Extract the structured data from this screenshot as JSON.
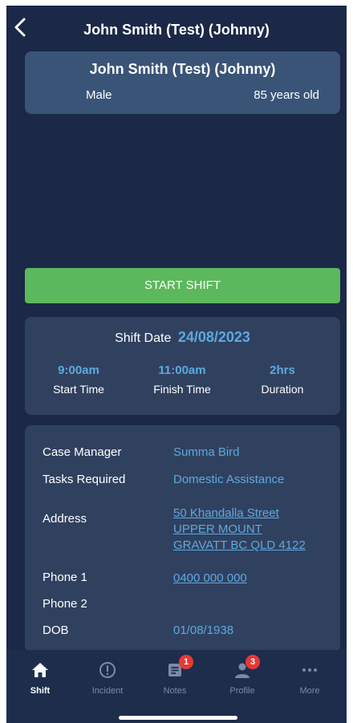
{
  "header": {
    "title": "John Smith (Test) (Johnny)"
  },
  "client": {
    "name": "John Smith (Test) (Johnny)",
    "gender": "Male",
    "age": "85 years old"
  },
  "actions": {
    "start_shift": "START SHIFT"
  },
  "shift": {
    "date_label": "Shift Date",
    "date_value": "24/08/2023",
    "start_time": "9:00am",
    "start_label": "Start Time",
    "finish_time": "11:00am",
    "finish_label": "Finish Time",
    "duration": "2hrs",
    "duration_label": "Duration"
  },
  "details": {
    "case_manager_label": "Case Manager",
    "case_manager": "Summa Bird",
    "tasks_label": "Tasks Required",
    "tasks": "Domestic Assistance",
    "address_label": "Address",
    "address_line1": "50 Khandalla Street",
    "address_line2": "UPPER MOUNT",
    "address_line3": "GRAVATT BC QLD 4122",
    "phone1_label": "Phone 1",
    "phone1": "0400 000 000",
    "phone2_label": "Phone 2",
    "phone2": "",
    "dob_label": "DOB",
    "dob": "01/08/1938"
  },
  "tabs": [
    {
      "label": "Shift",
      "icon": "home-icon",
      "active": true
    },
    {
      "label": "Incident",
      "icon": "alert-circle-icon"
    },
    {
      "label": "Notes",
      "icon": "notes-icon",
      "badge": "1"
    },
    {
      "label": "Profile",
      "icon": "person-icon",
      "badge": "3"
    },
    {
      "label": "More",
      "icon": "ellipsis-icon"
    }
  ],
  "colors": {
    "background": "#1b2847",
    "accent": "#5da9e0",
    "start_button": "#5cb85c",
    "badge": "#e53935"
  }
}
